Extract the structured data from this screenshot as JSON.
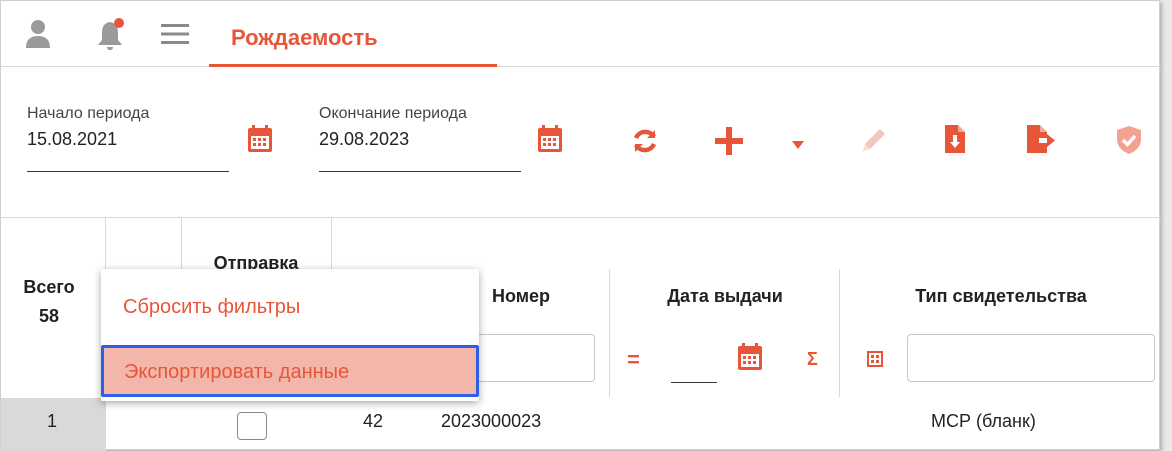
{
  "header": {
    "tab_label": "Рождаемость",
    "icons": [
      "user-icon",
      "bell-icon",
      "menu-icon"
    ],
    "accent_color": "#e8563a",
    "notification_dot_color": "#e8563a"
  },
  "filters": {
    "start": {
      "label": "Начало периода",
      "value": "15.08.2021"
    },
    "end": {
      "label": "Окончание периода",
      "value": "29.08.2023"
    }
  },
  "toolbar": {
    "icons": [
      "refresh-icon",
      "add-icon",
      "dropdown-arrow-icon",
      "edit-icon",
      "download-file-icon",
      "export-file-icon",
      "shield-check-icon"
    ]
  },
  "table": {
    "headers": {
      "total_label": "Всего",
      "total_count": "58",
      "send": "Отправка",
      "number": "Номер",
      "issue_date": "Дата выдачи",
      "cert_type": "Тип свидетельства"
    },
    "date_filter": {
      "equals": "=",
      "sigma": "Σ"
    },
    "rows": [
      {
        "index": "1",
        "count": "42",
        "number": "2023000023",
        "type": "МСР (бланк)"
      }
    ]
  },
  "context_menu": {
    "items": [
      {
        "label": "Сбросить фильтры"
      },
      {
        "label": "Экспортировать данные"
      }
    ],
    "highlight_color": "#f3b6aa",
    "focus_border_color": "#2f5fe8"
  }
}
